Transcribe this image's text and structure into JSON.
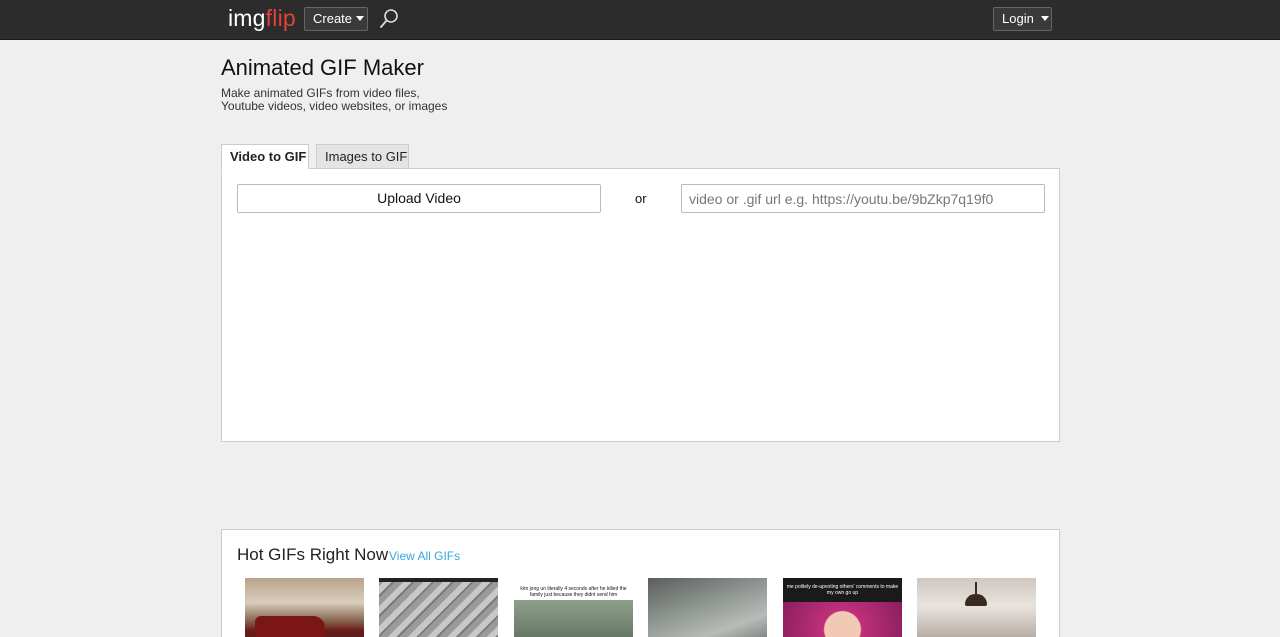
{
  "header": {
    "logo_img": "img",
    "logo_flip": "flip",
    "create_label": "Create",
    "login_label": "Login"
  },
  "page": {
    "title": "Animated GIF Maker",
    "subtitle": "Make animated GIFs from video files, Youtube videos, video websites, or images"
  },
  "tabs": [
    {
      "label": "Video to GIF",
      "active": true
    },
    {
      "label": "Images to GIF",
      "active": false
    }
  ],
  "maker": {
    "upload_label": "Upload Video",
    "or_label": "or",
    "url_placeholder": "video or .gif url e.g. https://youtu.be/9bZkp7q19f0"
  },
  "hot": {
    "title": "Hot GIFs Right Now",
    "view_all_label": "View All GIFs",
    "thumbs": [
      {
        "caption": ""
      },
      {
        "caption": ""
      },
      {
        "caption": "kim jong un literally 4 seconds after he killed the family just because they didnt send him"
      },
      {
        "caption": ""
      },
      {
        "caption": "me politely de-upvoting others' comments to make my own go up"
      },
      {
        "caption": ""
      }
    ]
  },
  "colors": {
    "topbar": "#2c2c2c",
    "logo_accent": "#e0423b",
    "link": "#3aa6d8",
    "background": "#efefef"
  },
  "icons": [
    "search-icon",
    "chevron-down-icon"
  ]
}
